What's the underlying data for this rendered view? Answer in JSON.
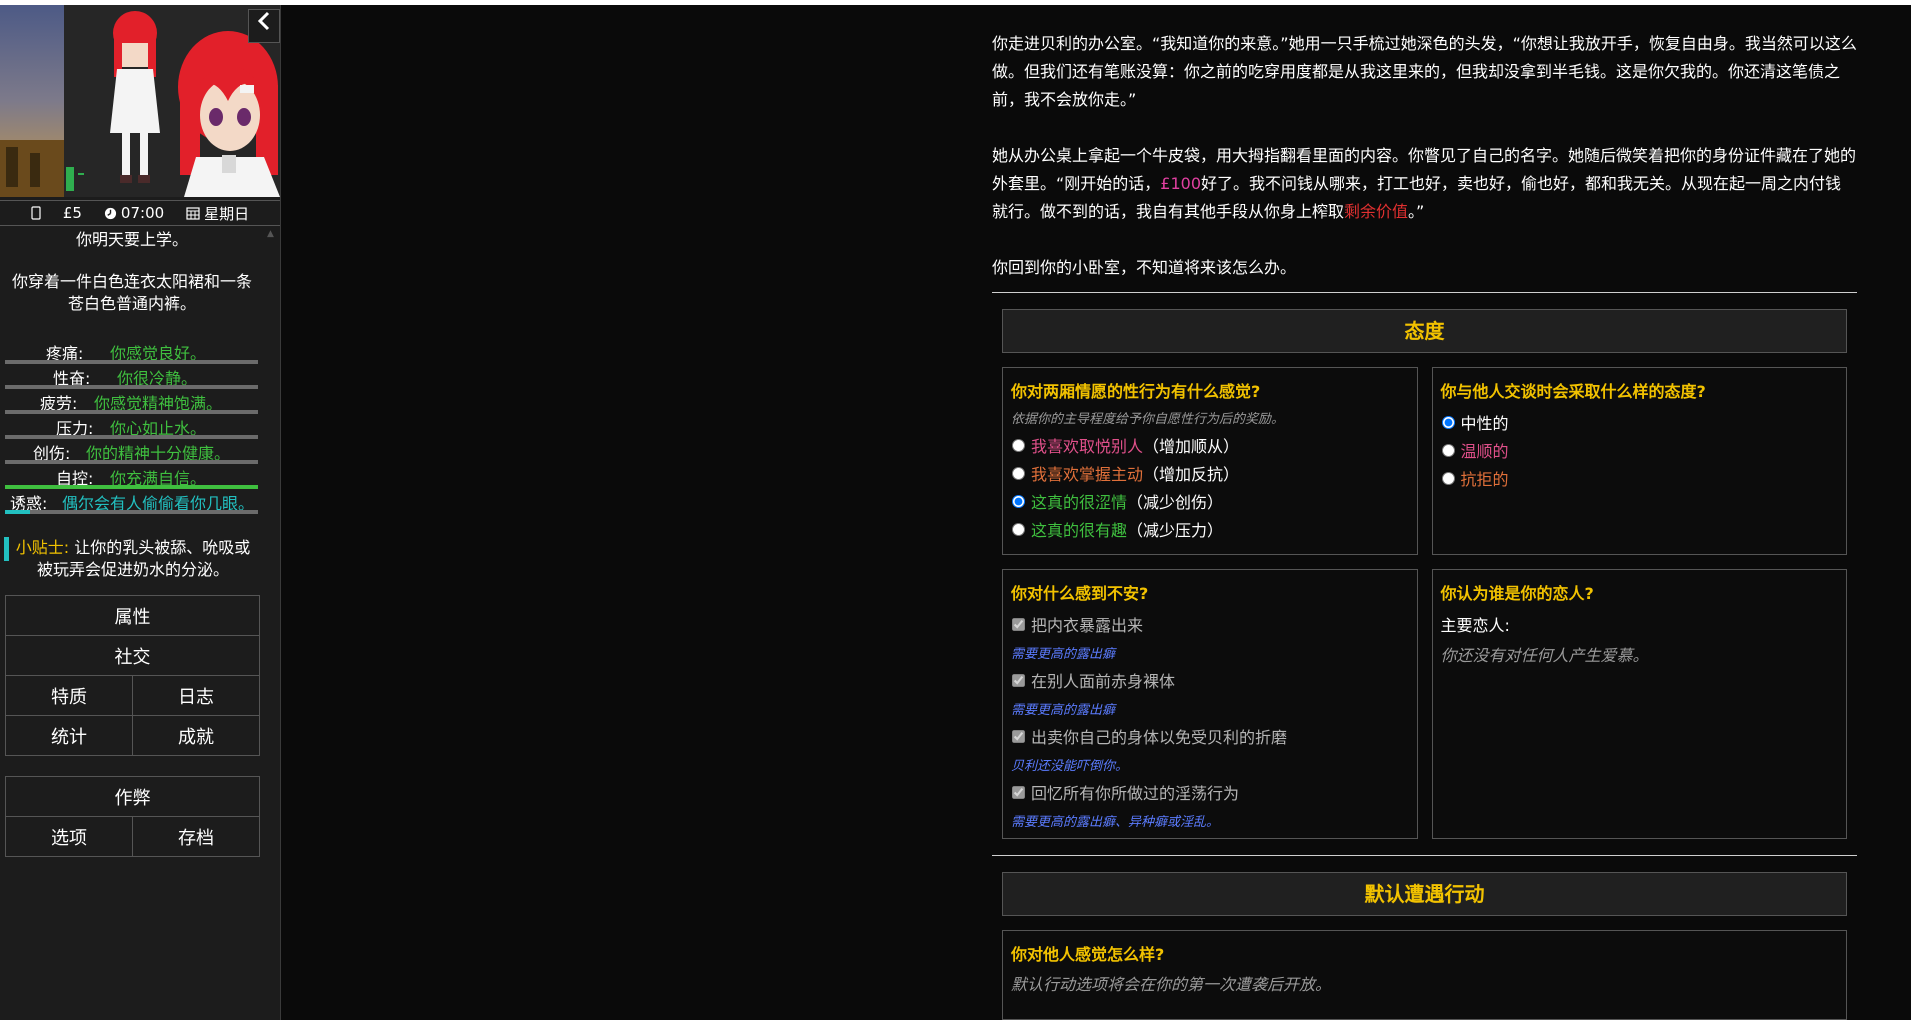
{
  "status": {
    "money": "£5",
    "time": "07:00",
    "day": "星期日"
  },
  "sidebar": {
    "line1": "你明天要上学。",
    "line2": "你穿着一件白色连衣太阳裙和一条苍白色普通内裤。",
    "stats": [
      {
        "label": "疼痛:",
        "desc": "你感觉良好。",
        "fill": 0.0,
        "color": "#3fbf3f"
      },
      {
        "label": "性奋:",
        "desc": "你很冷静。",
        "fill": 0.0,
        "color": "#3fbf3f"
      },
      {
        "label": "疲劳:",
        "desc": "你感觉精神饱满。",
        "fill": 0.0,
        "color": "#3fbf3f"
      },
      {
        "label": "压力:",
        "desc": "你心如止水。",
        "fill": 0.0,
        "color": "#3fbf3f"
      },
      {
        "label": "创伤:",
        "desc": "你的精神十分健康。",
        "fill": 0.0,
        "color": "#3fbf3f"
      },
      {
        "label": "自控:",
        "desc": "你充满自信。",
        "fill": 1.0,
        "color": "#3fbf3f"
      },
      {
        "label": "诱惑:",
        "desc": "偶尔会有人偷偷看你几眼。",
        "fill": 0.1,
        "color": "#22c0c0"
      }
    ],
    "tip_label": "小贴士:",
    "tip_text": "让你的乳头被舔、吮吸或被玩弄会促进奶水的分泌。",
    "menu1": [
      [
        "属性"
      ],
      [
        "社交"
      ],
      [
        "特质",
        "日志"
      ],
      [
        "统计",
        "成就"
      ]
    ],
    "menu2": [
      [
        "作弊"
      ],
      [
        "选项",
        "存档"
      ]
    ]
  },
  "story": {
    "p1": "你走进贝利的办公室。“我知道你的来意。”她用一只手梳过她深色的头发，“你想让我放开手，恢复自由身。我当然可以这么做。但我们还有笔账没算：你之前的吃穿用度都是从我这里来的，但我却没拿到半毛钱。这是你欠我的。你还清这笔债之前，我不会放你走。”",
    "p2a": "她从办公桌上拿起一个牛皮袋，用大拇指翻看里面的内容。你瞥见了自己的名字。她随后微笑着把你的身份证件藏在了她的外套里。“刚开始的话，",
    "p2_money": "£100",
    "p2b": "好了。我不问钱从哪来，打工也好，卖也好，偷也好，都和我无关。从现在起一周之内付钱就行。做不到的话，我自有其他手段从你身上榨取",
    "p2_red": "剩余价值",
    "p2c": "。”",
    "p3": "你回到你的小卧室，不知道将来该怎么办。"
  },
  "attitude": {
    "title": "态度",
    "q1": {
      "title": "你对两厢情愿的性行为有什么感觉?",
      "hint": "依据你的主导程度给予你自愿性行为后的奖励。",
      "options": [
        {
          "label": "我喜欢取悦别人",
          "note": "（增加顺从）"
        },
        {
          "label": "我喜欢掌握主动",
          "note": "（增加反抗）"
        },
        {
          "label": "这真的很涩情",
          "note": "（减少创伤）"
        },
        {
          "label": "这真的很有趣",
          "note": "（减少压力）"
        }
      ]
    },
    "q2": {
      "title": "你与他人交谈时会采取什么样的态度?",
      "options": [
        "中性的",
        "温顺的",
        "抗拒的"
      ]
    },
    "q3": {
      "title": "你对什么感到不安?",
      "items": [
        {
          "label": "把内衣暴露出来",
          "note": "需要更高的露出癖"
        },
        {
          "label": "在别人面前赤身裸体",
          "note": "需要更高的露出癖"
        },
        {
          "label": "出卖你自己的身体以免受贝利的折磨",
          "note": "贝利还没能吓倒你。"
        },
        {
          "label": "回忆所有你所做过的淫荡行为",
          "note": "需要更高的露出癖、异种癖或淫乱。"
        }
      ]
    },
    "q4": {
      "title": "你认为谁是你的恋人?",
      "label": "主要恋人:",
      "text": "你还没有对任何人产生爱慕。"
    }
  },
  "encounter": {
    "title": "默认遭遇行动",
    "q_title": "你对他人感觉怎么样?",
    "q_text": "默认行动选项将会在你的第一次遭袭后开放。"
  }
}
